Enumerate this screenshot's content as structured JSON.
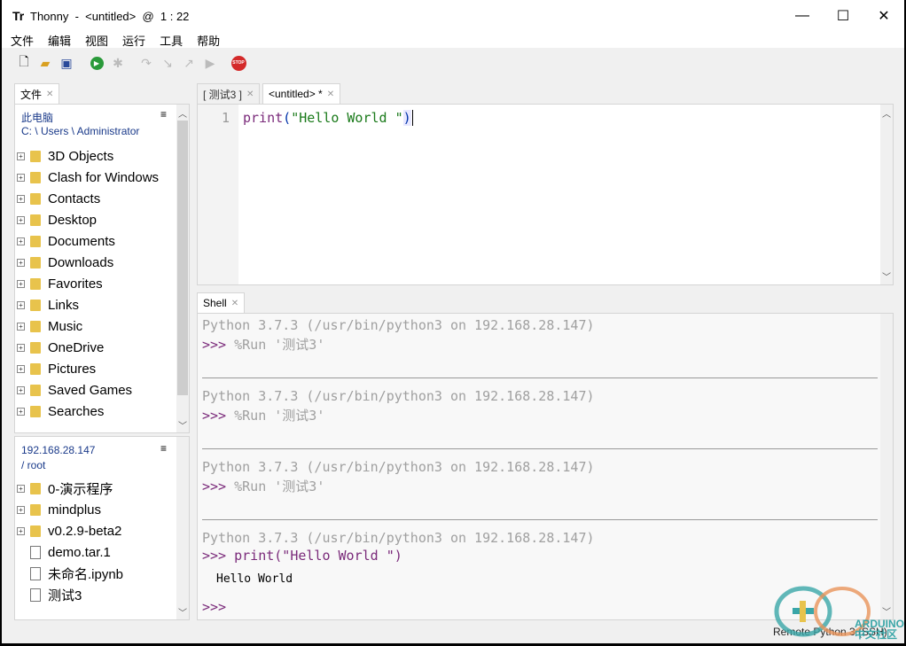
{
  "window": {
    "title": "Thonny  -  <untitled>  @  1 : 22",
    "logo": "Tr",
    "minimize": "—",
    "maximize": "☐",
    "close": "✕"
  },
  "menu": [
    "文件",
    "编辑",
    "视图",
    "运行",
    "工具",
    "帮助"
  ],
  "toolbar": [
    "new-file",
    "open-file",
    "save-file",
    "run",
    "debug",
    "step-over",
    "step-into",
    "step-out",
    "resume",
    "stop"
  ],
  "files_panel": {
    "tab": "文件",
    "local": {
      "label": "此电脑",
      "path": "C: \\ Users \\ Administrator",
      "items": [
        "3D Objects",
        "Clash for Windows",
        "Contacts",
        "Desktop",
        "Documents",
        "Downloads",
        "Favorites",
        "Links",
        "Music",
        "OneDrive",
        "Pictures",
        "Saved Games",
        "Searches"
      ]
    },
    "remote": {
      "label": "192.168.28.147",
      "path": "/ root",
      "folders": [
        "0-演示程序",
        "mindplus",
        "v0.2.9-beta2"
      ],
      "files": [
        "demo.tar.1",
        "未命名.ipynb",
        "测试3"
      ]
    },
    "menu_icon": "≡"
  },
  "editor": {
    "tabs": [
      "[ 测试3 ]",
      "<untitled> *"
    ],
    "line_number": "1",
    "code": {
      "fn": "print",
      "open": "(",
      "str": "\"Hello World \"",
      "close": ")"
    }
  },
  "shell": {
    "tab": "Shell",
    "banner": "Python 3.7.3 (/usr/bin/python3 on 192.168.28.147)",
    "prompt": ">>>",
    "runs": [
      "%Run '测试3'",
      "%Run '测试3'",
      "%Run '测试3'"
    ],
    "last_cmd": "print(\"Hello World \")",
    "output": "Hello World"
  },
  "status": "Remote Python 3 (SSH)",
  "watermark": "ARDUINO 中文社区"
}
